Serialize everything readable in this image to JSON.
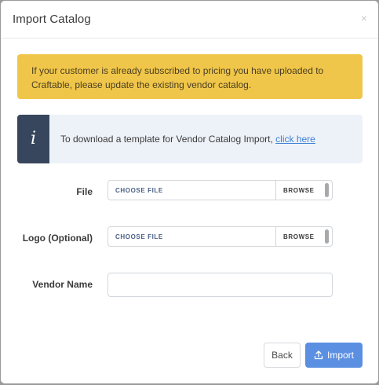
{
  "modal": {
    "title": "Import Catalog",
    "close_label": "×"
  },
  "warning": {
    "text": "If your customer is already subscribed to pricing you have uploaded to Craftable, please update the existing vendor catalog."
  },
  "info": {
    "icon": "info-icon",
    "icon_glyph": "i",
    "text": "To download a template for Vendor Catalog Import, ",
    "link": "click here"
  },
  "form": {
    "file": {
      "label": "File",
      "placeholder": "CHOOSE FILE",
      "browse": "BROWSE"
    },
    "logo": {
      "label": "Logo (Optional)",
      "placeholder": "CHOOSE FILE",
      "browse": "BROWSE"
    },
    "vendor_name": {
      "label": "Vendor Name",
      "value": ""
    }
  },
  "footer": {
    "back_label": "Back",
    "import_label": "Import"
  },
  "colors": {
    "warning_bg": "#f0c64a",
    "info_icon_bg": "#38465d",
    "info_bg": "#edf2f8",
    "primary": "#5b8fe2",
    "link": "#3d7fd6"
  }
}
